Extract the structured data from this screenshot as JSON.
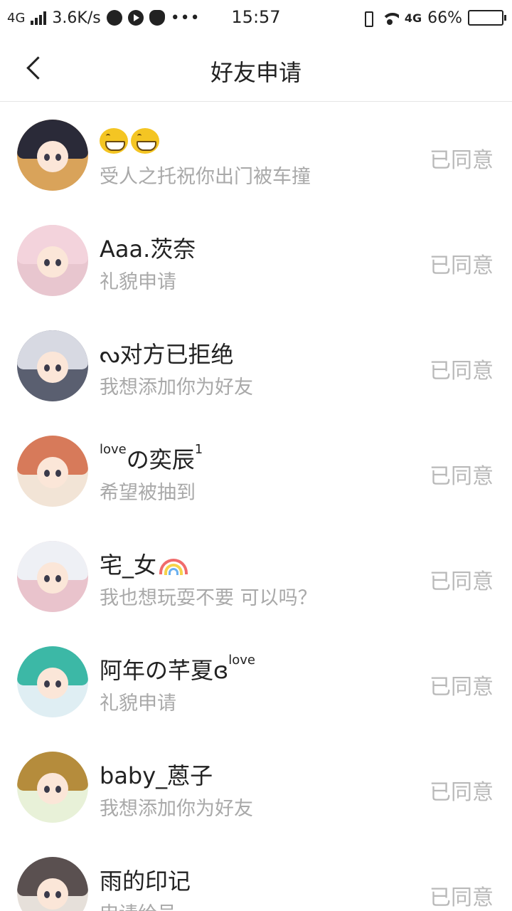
{
  "status_bar": {
    "network": "4G",
    "speed": "3.6K/s",
    "time": "15:57",
    "mobile_data": "4G",
    "battery": "66%",
    "battery_level": 0.66
  },
  "nav": {
    "title": "好友申请"
  },
  "requests": [
    {
      "name": "",
      "name_has_emoji": true,
      "message": "受人之托祝你出门被车撞",
      "status": "已同意",
      "avatar_colors": {
        "hair": "#2a2a38",
        "bg": "#d9a35a"
      }
    },
    {
      "name": "Aaa.茨奈",
      "message": "礼貌申请",
      "status": "已同意",
      "avatar_colors": {
        "hair": "#f3d3dc",
        "bg": "#e8c6cf"
      }
    },
    {
      "name": "ᔓ对方已拒绝",
      "message": "我想添加你为好友",
      "status": "已同意",
      "avatar_colors": {
        "hair": "#d7d9e2",
        "bg": "#5a5f70"
      }
    },
    {
      "name_prefix": "love",
      "name": "の奕辰",
      "name_suffix": "1",
      "message": "希望被抽到",
      "status": "已同意",
      "avatar_colors": {
        "hair": "#d77a5a",
        "bg": "#f2e4d6"
      }
    },
    {
      "name": "宅_女",
      "name_has_rainbow": true,
      "message": "我也想玩耍不要 可以吗？",
      "status": "已同意",
      "avatar_colors": {
        "hair": "#eef0f5",
        "bg": "#e9c3cc"
      }
    },
    {
      "name": "阿年の芊夏ɞ",
      "name_suffix": "love",
      "message": "礼貌申请",
      "status": "已同意",
      "avatar_colors": {
        "hair": "#3cb8a6",
        "bg": "#dfeef3"
      }
    },
    {
      "name": "baby_蒽子",
      "message": "我想添加你为好友",
      "status": "已同意",
      "avatar_colors": {
        "hair": "#b58c3c",
        "bg": "#e8f1d8"
      }
    },
    {
      "name": "雨的印记",
      "message": "申请给号",
      "status": "已同意",
      "avatar_colors": {
        "hair": "#5a5050",
        "bg": "#e6e0da"
      }
    }
  ]
}
